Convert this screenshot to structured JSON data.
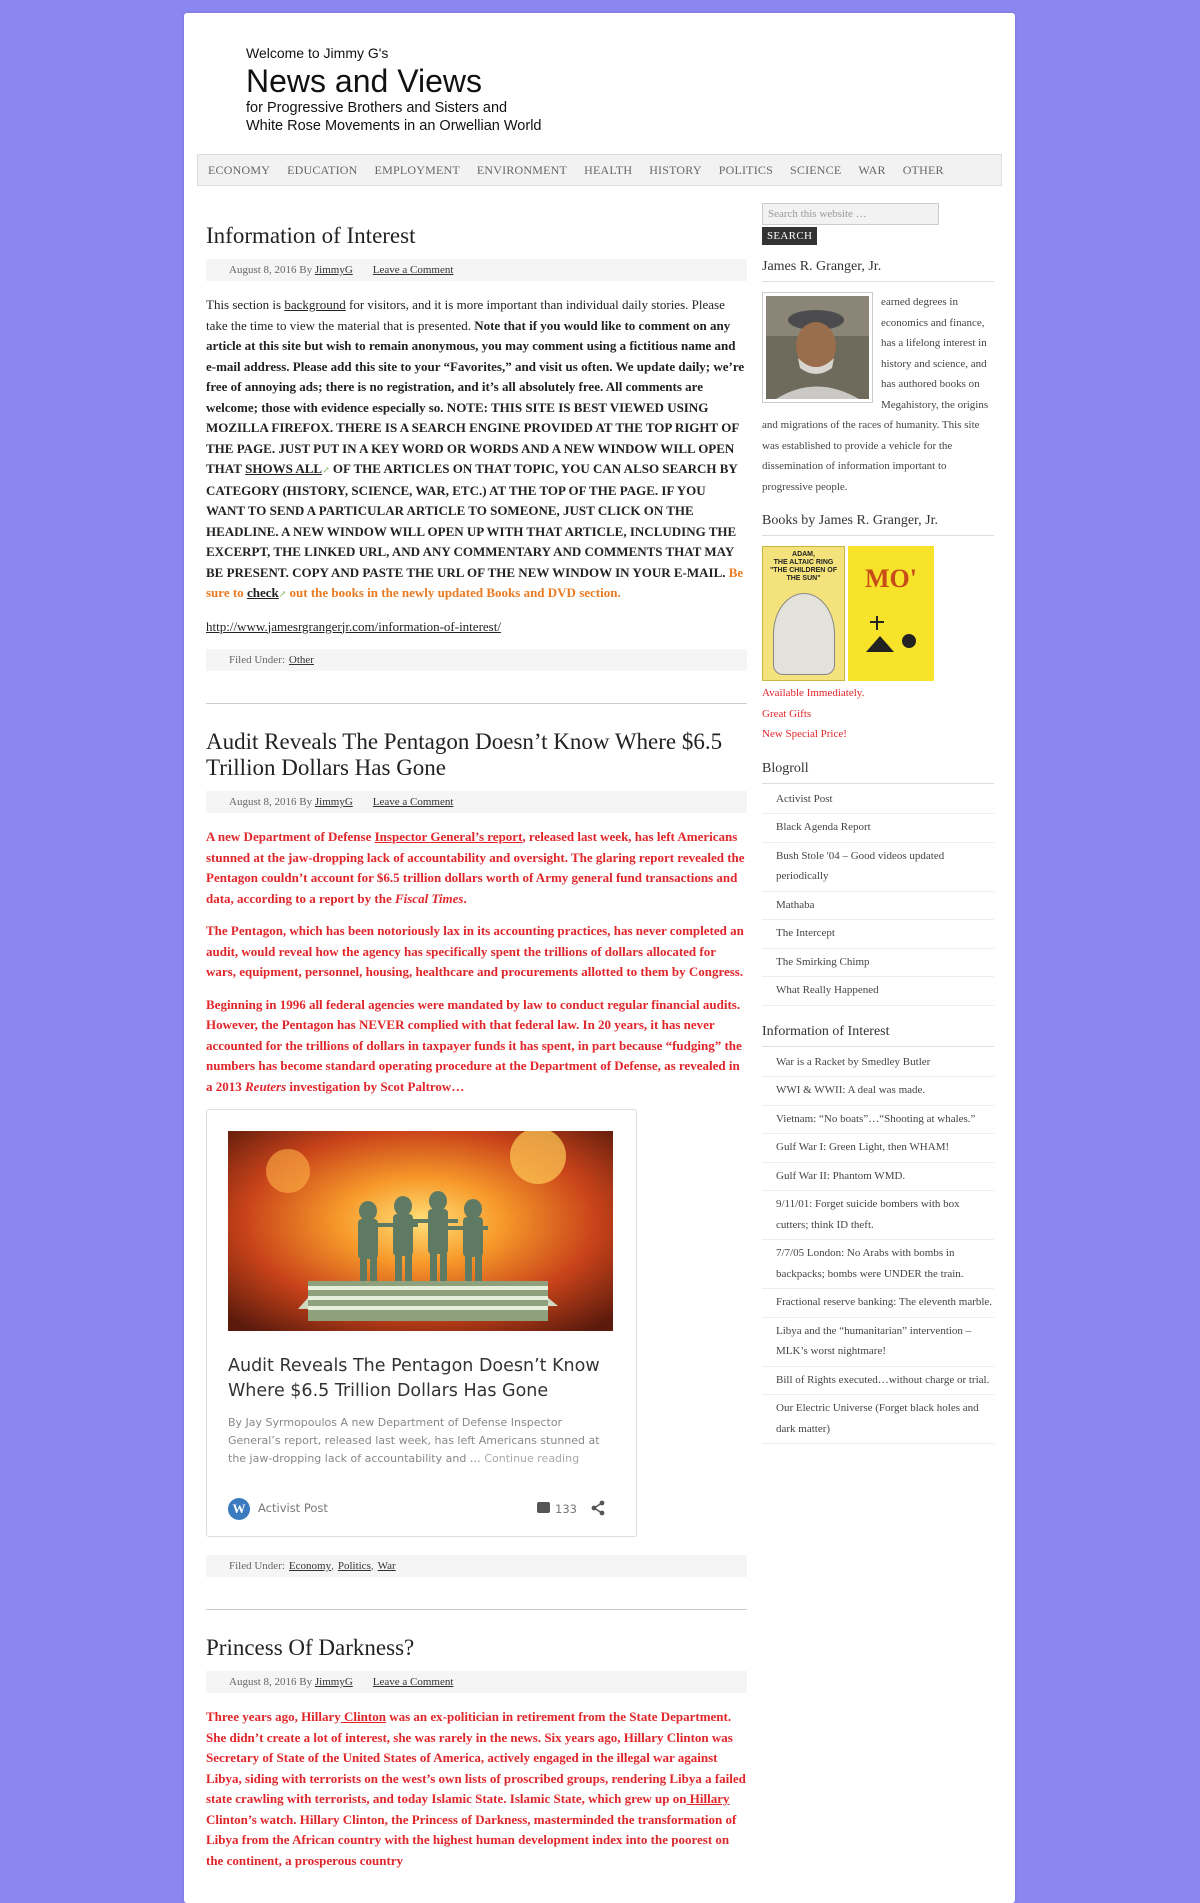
{
  "header": {
    "welcome": "Welcome to Jimmy G's",
    "title": "News and Views",
    "subtitle_line1": "for Progressive Brothers and Sisters and",
    "subtitle_line2": "White Rose Movements in an Orwellian World"
  },
  "nav": {
    "items": [
      "ECONOMY",
      "EDUCATION",
      "EMPLOYMENT",
      "ENVIRONMENT",
      "HEALTH",
      "HISTORY",
      "POLITICS",
      "SCIENCE",
      "WAR",
      "OTHER"
    ]
  },
  "posts": {
    "p1": {
      "title": "Information of Interest",
      "date": "August 8, 2016 By",
      "author": "JimmyG",
      "comment": "Leave a Comment",
      "t1": "This section is",
      "t_link": "background",
      "t2": "for visitors, and it is more important than individual daily stories. Please take the time to view the material that is presented.",
      "bold1": "Note that if you would like to comment on any article at this site but wish to remain anonymous, you may comment using a fictitious name and e-mail address. Please add this site to your “Favorites,” and visit us often. We update daily; we’re free of annoying ads; there is no registration, and it’s all absolutely free. All comments are welcome; those with evidence especially so. NOTE: THIS SITE IS BEST VIEWED USING MOZILLA FIREFOX. THERE IS A SEARCH ENGINE PROVIDED AT THE TOP RIGHT OF THE PAGE. JUST PUT IN A KEY WORD OR WORDS AND A NEW WINDOW WILL OPEN THAT",
      "shows_all": "SHOWS ALL",
      "bold2": "OF THE ARTICLES ON THAT TOPIC, YOU CAN ALSO SEARCH BY CATEGORY (HISTORY, SCIENCE, WAR, ETC.) AT THE TOP OF THE PAGE. IF YOU WANT TO SEND A PARTICULAR ARTICLE TO SOMEONE, JUST CLICK ON THE HEADLINE. A NEW WINDOW WILL OPEN UP WITH THAT ARTICLE, INCLUDING THE EXCERPT, THE LINKED URL, AND ANY COMMENTARY AND COMMENTS THAT MAY BE PRESENT. COPY AND PASTE THE URL OF THE NEW WINDOW IN YOUR E-MAIL.",
      "orange1": "Be sure to",
      "check": "check",
      "orange2": "out the books in the newly updated Books and DVD section.",
      "url": "http://www.jamesrgrangerjr.com/information-of-interest/",
      "filed_label": "Filed Under:",
      "filed_cat": "Other"
    },
    "p2": {
      "title": "Audit Reveals The Pentagon Doesn’t Know Where $6.5 Trillion Dollars Has Gone",
      "date": "August 8, 2016 By",
      "author": "JimmyG",
      "comment": "Leave a Comment",
      "para1_a": "A new Department of Defense",
      "para1_link": "Inspector General’s report",
      "para1_b": ", released last week, has left Americans stunned at the jaw-dropping lack of accountability and oversight. The glaring report revealed the Pentagon couldn’t account for $6.5 trillion dollars worth of Army general fund transactions and data, according to a report by the",
      "para1_em": "Fiscal Times",
      "para1_c": ".",
      "para2": "The Pentagon, which has been notoriously lax in its accounting practices, has never completed an audit, would reveal how the agency has specifically spent the trillions of dollars allocated for wars, equipment, personnel, housing, healthcare and procurements allotted to them by Congress.",
      "para3_a": "Beginning in 1996 all federal agencies were mandated by law to conduct regular financial audits. However, the Pentagon has NEVER complied with that federal law. In 20 years, it has never accounted for the trillions of dollars in taxpayer funds it has spent, in part because “fudging” the numbers has become standard operating procedure at the Department of Defense, as revealed in a 2013",
      "para3_em": "Reuters",
      "para3_b": "investigation by Scot Paltrow…",
      "card": {
        "title": "Audit Reveals The Pentagon Doesn’t Know Where $6.5 Trillion Dollars Has Gone",
        "excerpt": "By Jay Syrmopoulos A new Department of Defense Inspector General’s report, released last week, has left Americans stunned at the jaw-dropping lack of accountability and …",
        "more": "Continue reading",
        "source": "Activist Post",
        "comments": "133"
      },
      "filed_label": "Filed Under:",
      "filed_cats": [
        "Economy",
        "Politics",
        "War"
      ]
    },
    "p3": {
      "title": "Princess Of Darkness?",
      "date": "August 8, 2016 By",
      "author": "JimmyG",
      "comment": "Leave a Comment",
      "a": "Three years ago, Hillary",
      "link1": " Clinton",
      "b": "was an ex-politician in retirement from the State Department. She didn’t create a lot of interest, she was rarely in the news. Six years ago, Hillary Clinton was Secretary of State of the United States of America, actively engaged in the illegal war against Libya, siding with terrorists on the west’s own lists of proscribed groups, rendering Libya a failed state crawling with terrorists, and today Islamic State. Islamic State, which grew up on",
      "link2": " Hillary",
      "c": "Clinton’s watch. Hillary Clinton, the Princess of Darkness, masterminded the transformation of Libya from the African country with the highest human development index into the poorest on the continent, a prosperous country"
    }
  },
  "sidebar": {
    "search_placeholder": "Search this website …",
    "search_button": "SEARCH",
    "about_title": "James R. Granger, Jr.",
    "about_text": "earned degrees in economics and finance, has a lifelong interest in history and science, and has authored books on Megahistory, the origins and migrations of the races of humanity. This site was established to provide a vehicle for the dissemination of information important to progressive people.",
    "books_title": "Books by James R. Granger, Jr.",
    "book1_cover": [
      "ADAM,",
      "THE ALTAIC RING",
      "\"THE CHILDREN OF",
      "THE SUN\""
    ],
    "book2_cover": "MO'",
    "books_links": [
      "Available Immediately.",
      "Great Gifts",
      "New Special Price!"
    ],
    "blogroll_title": "Blogroll",
    "blogroll": [
      "Activist Post",
      "Black Agenda Report",
      "Bush Stole '04 – Good videos updated periodically",
      "Mathaba",
      "The Intercept",
      "The Smirking Chimp",
      "What Really Happened"
    ],
    "info_title": "Information of Interest",
    "info": [
      "War is a Racket by Smedley Butler",
      "WWI & WWII: A deal was made.",
      "Vietnam: “No boats”…“Shooting at whales.”",
      "Gulf War I: Green Light, then WHAM!",
      "Gulf War II: Phantom WMD.",
      "9/11/01: Forget suicide bombers with box cutters; think ID theft.",
      "7/7/05 London: No Arabs with bombs in backpacks; bombs were UNDER the train.",
      "Fractional reserve banking: The eleventh marble.",
      "Libya and the “humanitarian” intervention – MLK’s worst nightmare!",
      "Bill of Rights executed…without charge or trial.",
      "Our Electric Universe (Forget black holes and dark matter)"
    ]
  },
  "colors": {
    "background": "#8b87f0",
    "red_text": "#e0262a",
    "orange_text": "#e97a21"
  }
}
